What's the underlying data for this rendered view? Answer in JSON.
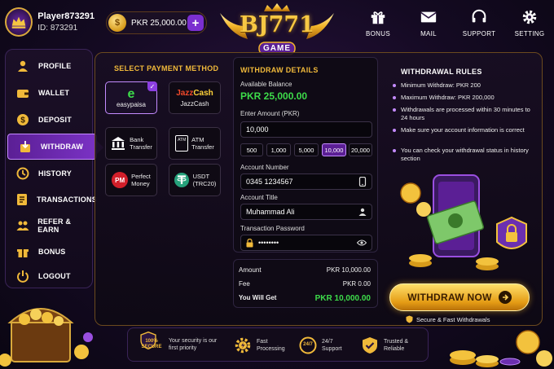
{
  "profile": {
    "username": "Player873291",
    "id_label": "ID: 873291"
  },
  "balance": {
    "currency_symbol": "$",
    "text": "PKR  25,000.00",
    "add_label": "+"
  },
  "logo": {
    "title": "BJ771",
    "subtitle": "GAME"
  },
  "top_actions": [
    {
      "label": "BONUS",
      "icon": "gift-icon"
    },
    {
      "label": "MAIL",
      "icon": "mail-icon"
    },
    {
      "label": "SUPPORT",
      "icon": "headset-icon"
    },
    {
      "label": "SETTING",
      "icon": "gear-icon"
    }
  ],
  "sidebar": {
    "items": [
      {
        "label": "PROFILE",
        "icon": "user-icon"
      },
      {
        "label": "WALLET",
        "icon": "wallet-icon"
      },
      {
        "label": "DEPOSIT",
        "icon": "dollar-coin-icon"
      },
      {
        "label": "WITHDRAW",
        "icon": "withdraw-icon",
        "active": true
      },
      {
        "label": "HISTORY",
        "icon": "clock-icon"
      },
      {
        "label": "TRANSACTIONS",
        "icon": "list-icon"
      },
      {
        "label": "REFER & EARN",
        "icon": "people-icon"
      },
      {
        "label": "BONUS",
        "icon": "gift-icon"
      },
      {
        "label": "LOGOUT",
        "icon": "power-icon"
      }
    ]
  },
  "payment": {
    "title": "SELECT PAYMENT METHOD",
    "methods": [
      {
        "label": "easypaisa",
        "icon": "easypaisa-logo",
        "selected": true
      },
      {
        "label": "JazzCash",
        "icon": "jazzcash-logo"
      },
      {
        "label": "Bank\nTransfer",
        "icon": "bank-icon"
      },
      {
        "label": "ATM\nTransfer",
        "icon": "atm-card-icon"
      },
      {
        "label": "Perfect\nMoney",
        "icon": "perfect-money-logo"
      },
      {
        "label": "USDT\n(TRC20)",
        "icon": "tether-icon"
      }
    ],
    "easypaisa_mark": "e",
    "jazz_word": "Jazz",
    "cash_word": "Cash",
    "pm_mark": "PM",
    "atm_mark": "ATM"
  },
  "details": {
    "title": "WITHDRAW DETAILS",
    "available_label": "Available Balance",
    "available_value": "PKR 25,000.00",
    "amount_label": "Enter Amount (PKR)",
    "amount_value": "10,000",
    "quick_amounts": [
      "500",
      "1,000",
      "5,000",
      "10,000",
      "20,000"
    ],
    "selected_amount": "10,000",
    "account_number_label": "Account Number",
    "account_number_value": "0345 1234567",
    "account_title_label": "Account Title",
    "account_title_value": "Muhammad Ali",
    "password_label": "Transaction Password",
    "password_value": "••••••••"
  },
  "summary": {
    "rows": [
      {
        "label": "Amount",
        "value": "PKR 10,000.00"
      },
      {
        "label": "Fee",
        "value": "PKR 0.00"
      },
      {
        "label": "You Will Get",
        "value": "PKR 10,000.00"
      }
    ]
  },
  "rules": {
    "title": "WITHDRAWAL RULES",
    "items": [
      "Minimum Withdraw: PKR 200",
      "Maximum Withdraw: PKR 200,000",
      "Withdrawals are processed within 30 minutes to 24 hours",
      "Make sure your account information is correct",
      "You can check your withdrawal status in history section"
    ]
  },
  "withdraw_button": {
    "label": "WITHDRAW NOW"
  },
  "secure_note": "Secure & Fast Withdrawals",
  "features": [
    {
      "badge": "100%\nSECURE",
      "text": "Your security is our\nfirst priority",
      "icon": "shield-badge-icon"
    },
    {
      "text": "Fast\nProcessing",
      "icon": "gear-bolt-icon"
    },
    {
      "badge": "24/7",
      "text": "24/7\nSupport",
      "icon": "support-clock-icon"
    },
    {
      "text": "Trusted &\nReliable",
      "icon": "shield-check-icon"
    }
  ],
  "colors": {
    "accent_purple": "#7b2fd0",
    "gold": "#f0b93a",
    "green_value": "#3ddc4a",
    "background": "#140a22"
  }
}
